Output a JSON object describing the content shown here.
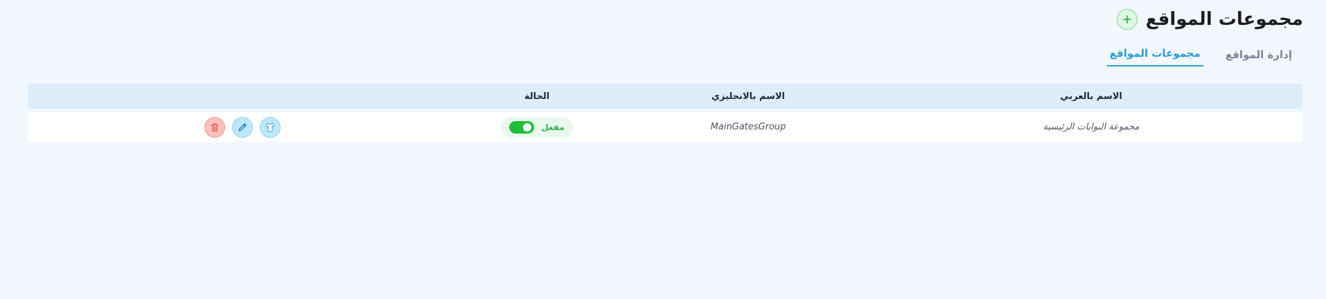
{
  "header": {
    "title": "مجموعات المواقع",
    "add_icon": "plus-icon"
  },
  "tabs": [
    {
      "label": "إدارة المواقع",
      "active": false
    },
    {
      "label": "مجموعات المواقع",
      "active": true
    }
  ],
  "table": {
    "columns": {
      "name_ar": "الاسم بالعربي",
      "name_en": "الاسم بالانجليزي",
      "status": "الحالة"
    },
    "rows": [
      {
        "name_ar": "مجموعة البوابات الرئيسية",
        "name_en": "MainGatesGroup",
        "status_label": "مفعل",
        "enabled": true
      }
    ]
  },
  "colors": {
    "accent": "#2a9fd6",
    "enabled": "#1fbf3a",
    "danger": "#e8554a"
  }
}
